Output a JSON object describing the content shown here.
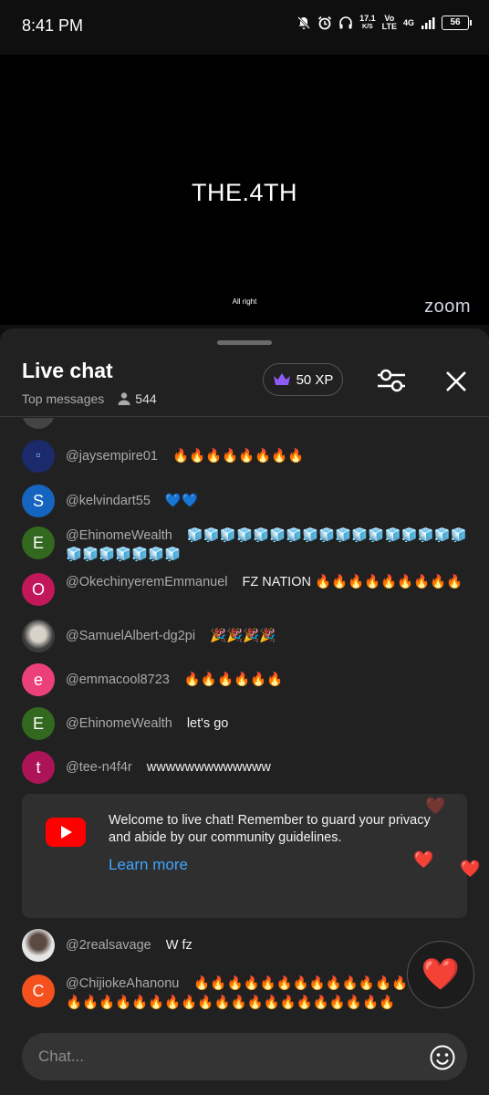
{
  "status": {
    "time": "8:41 PM",
    "speed": "17.1",
    "speed_unit": "K/S",
    "vo": "Vo",
    "lte": "LTE",
    "net": "4G",
    "battery": "56"
  },
  "video": {
    "title": "THE.4TH",
    "caption": "All right",
    "logo": "zoom"
  },
  "chat": {
    "title": "Live chat",
    "mode": "Top messages",
    "viewers": "544",
    "xp": "50 XP",
    "messages": [
      {
        "author": "@jaysempire01",
        "text": "🔥🔥🔥🔥🔥🔥🔥🔥",
        "avatar": "",
        "avatar_color": "#1b2a6b"
      },
      {
        "author": "@kelvindart55",
        "text": "💙💙",
        "avatar": "S",
        "avatar_color": "#1565c0"
      },
      {
        "author": "@EhinomeWealth",
        "text": "🧊🧊🧊🧊🧊🧊🧊🧊🧊🧊🧊🧊🧊🧊🧊🧊🧊🧊🧊🧊🧊🧊🧊🧊",
        "avatar": "E",
        "avatar_color": "#33691e"
      },
      {
        "author": "@OkechinyeremEmmanuel",
        "text": "FZ NATION 🔥🔥🔥🔥🔥🔥🔥🔥🔥",
        "avatar": "O",
        "avatar_color": "#c2185b"
      },
      {
        "author": "@SamuelAlbert-dg2pi",
        "text": "🎉🎉🎉🎉",
        "avatar": "",
        "avatar_color": "#555555"
      },
      {
        "author": "@emmacool8723",
        "text": "🔥🔥🔥🔥🔥🔥",
        "avatar": "e",
        "avatar_color": "#ec407a"
      },
      {
        "author": "@EhinomeWealth",
        "text": "let's go",
        "avatar": "E",
        "avatar_color": "#33691e"
      },
      {
        "author": "@tee-n4f4r",
        "text": "wwwwwwwwwwwww",
        "avatar": "t",
        "avatar_color": "#ad1457"
      },
      {
        "author": "@2realsavage",
        "text": "W fz",
        "avatar": "",
        "avatar_color": "#9e9e9e"
      },
      {
        "author": "@ChijiokeAhanonu",
        "text": "🔥🔥🔥🔥🔥🔥🔥🔥🔥🔥🔥🔥🔥🔥🔥🔥🔥🔥🔥🔥🔥🔥🔥🔥🔥🔥🔥🔥🔥🔥🔥🔥🔥🔥",
        "avatar": "C",
        "avatar_color": "#f4511e"
      }
    ],
    "banner": {
      "text": "Welcome to live chat! Remember to guard your privacy and abide by our community guidelines.",
      "link": "Learn more"
    },
    "input_placeholder": "Chat..."
  },
  "colors": {
    "background": "#0f0f0f",
    "sheet": "#212121",
    "link": "#3ea6ff",
    "youtube_red": "#ff0000"
  }
}
